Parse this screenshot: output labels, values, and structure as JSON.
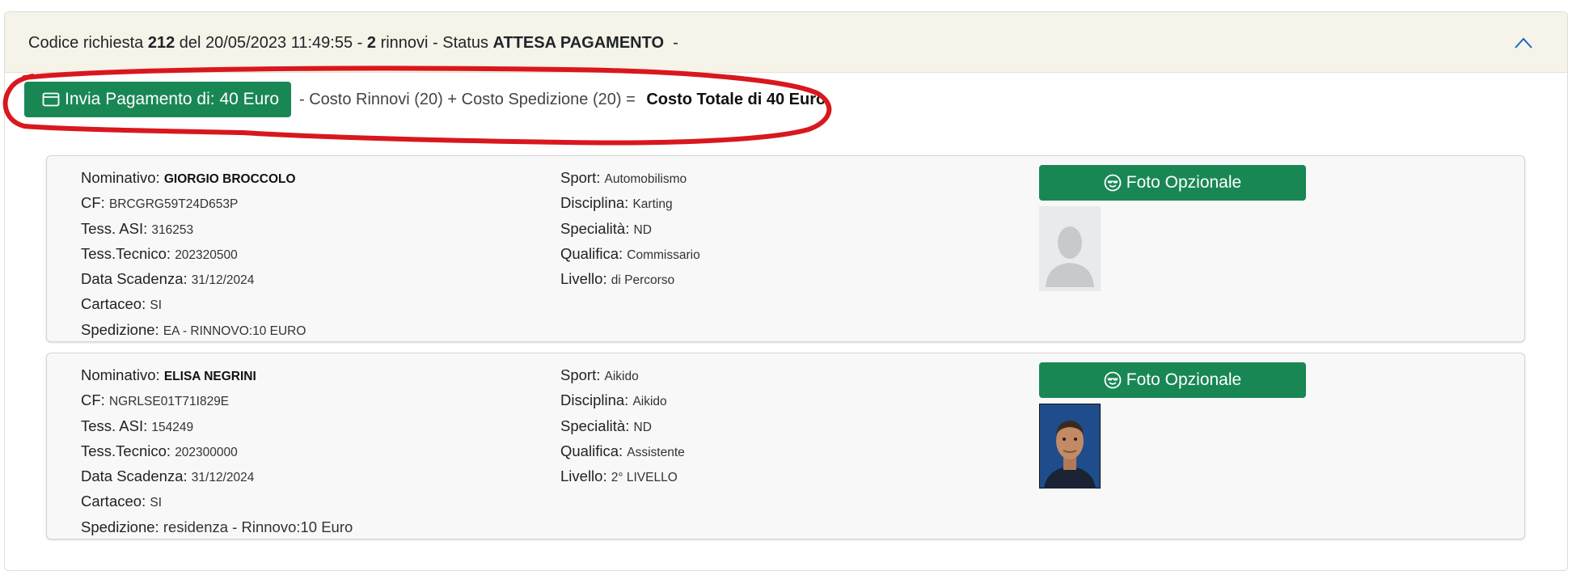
{
  "header": {
    "codice_label": "Codice richiesta",
    "codice": "212",
    "del_label": "del",
    "date": "20/05/2023 11:49:55",
    "dash1": "-",
    "rinnovi_count": "2",
    "rinnovi_label": "rinnovi - Status",
    "status": "ATTESA PAGAMENTO",
    "dash2": "-",
    "collapse_icon": "chevron-up-icon"
  },
  "payment": {
    "button_label": "Invia Pagamento di: 40 Euro",
    "button_icon": "credit-card-icon",
    "info": "- Costo Rinnovi (20) + Costo Spedizione (20) =",
    "total": "Costo Totale di 40 Euro",
    "accent": "#198754",
    "annotation_color": "#d9171e"
  },
  "persons": [
    {
      "nominativo_label": "Nominativo:",
      "nominativo": "GIORGIO BROCCOLO",
      "cf_label": "CF:",
      "cf": "BRCGRG59T24D653P",
      "asi_label": "Tess. ASI:",
      "asi": "316253",
      "tecnico_label": "Tess.Tecnico:",
      "tecnico": "202320500",
      "scadenza_label": "Data Scadenza:",
      "scadenza": "31/12/2024",
      "cartaceo_label": "Cartaceo:",
      "cartaceo": "SI",
      "spedizione_label": "Spedizione:",
      "spedizione": "EA - RINNOVO:10 EURO",
      "sport_label": "Sport:",
      "sport": "Automobilismo",
      "disciplina_label": "Disciplina:",
      "disciplina": "Karting",
      "specialita_label": "Specialità:",
      "specialita": "ND",
      "qualifica_label": "Qualifica:",
      "qualifica": "Commissario",
      "livello_label": "Livello:",
      "livello": "di Percorso",
      "foto_label": "Foto Opzionale",
      "foto_icon": "smiling-face-sunglasses-icon",
      "photo": "placeholder-avatar"
    },
    {
      "nominativo_label": "Nominativo:",
      "nominativo": "ELISA NEGRINI",
      "cf_label": "CF:",
      "cf": "NGRLSE01T71I829E",
      "asi_label": "Tess. ASI:",
      "asi": "154249",
      "tecnico_label": "Tess.Tecnico:",
      "tecnico": "202300000",
      "scadenza_label": "Data Scadenza:",
      "scadenza": "31/12/2024",
      "cartaceo_label": "Cartaceo:",
      "cartaceo": "SI",
      "spedizione_label": "Spedizione:",
      "spedizione": "residenza - Rinnovo:10 Euro",
      "sport_label": "Sport:",
      "sport": "Aikido",
      "disciplina_label": "Disciplina:",
      "disciplina": "Aikido",
      "specialita_label": "Specialità:",
      "specialita": "ND",
      "qualifica_label": "Qualifica:",
      "qualifica": "Assistente",
      "livello_label": "Livello:",
      "livello": "2° LIVELLO",
      "foto_label": "Foto Opzionale",
      "foto_icon": "smiling-face-sunglasses-icon",
      "photo": "portrait-photo"
    }
  ]
}
